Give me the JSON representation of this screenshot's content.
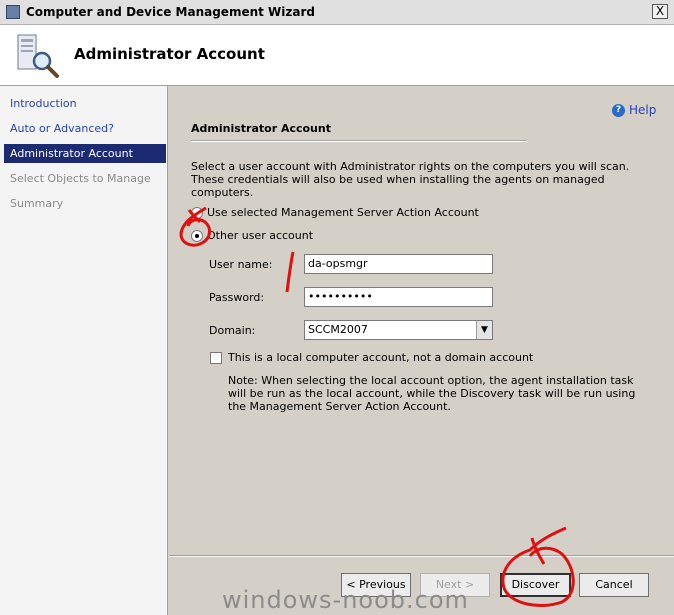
{
  "window": {
    "title": "Computer and Device Management Wizard",
    "close_glyph": "X"
  },
  "header": {
    "title": "Administrator Account"
  },
  "nav": {
    "items": [
      {
        "label": "Introduction",
        "state": "link"
      },
      {
        "label": "Auto or Advanced?",
        "state": "link"
      },
      {
        "label": "Administrator Account",
        "state": "active"
      },
      {
        "label": "Select Objects to Manage",
        "state": "disabled"
      },
      {
        "label": "Summary",
        "state": "disabled"
      }
    ]
  },
  "help": {
    "label": "Help",
    "icon": "question-icon"
  },
  "section": {
    "title": "Administrator Account",
    "description": "Select a user account with Administrator rights on the computers you will scan. These credentials will also be used when installing the agents on managed computers."
  },
  "options": {
    "use_selected": "Use selected Management Server Action Account",
    "other_user": "Other user account",
    "selected": "other_user"
  },
  "form": {
    "username_label": "User name:",
    "username_value": "da-opsmgr",
    "password_label": "Password:",
    "password_value": "••••••••••",
    "domain_label": "Domain:",
    "domain_value": "SCCM2007",
    "local_checkbox_label": "This is a local computer account, not a domain account",
    "local_checkbox_checked": false
  },
  "note": "Note:  When selecting the local account option, the agent installation task will be run as the local account, while the Discovery task will be run using the Management Server Action Account.",
  "buttons": {
    "previous": "< Previous",
    "next": "Next >",
    "discover": "Discover",
    "cancel": "Cancel"
  },
  "watermark": "windows-noob.com",
  "colors": {
    "nav_active_bg": "#1c2a72",
    "link": "#2a40c0",
    "annotation": "#e01010"
  }
}
